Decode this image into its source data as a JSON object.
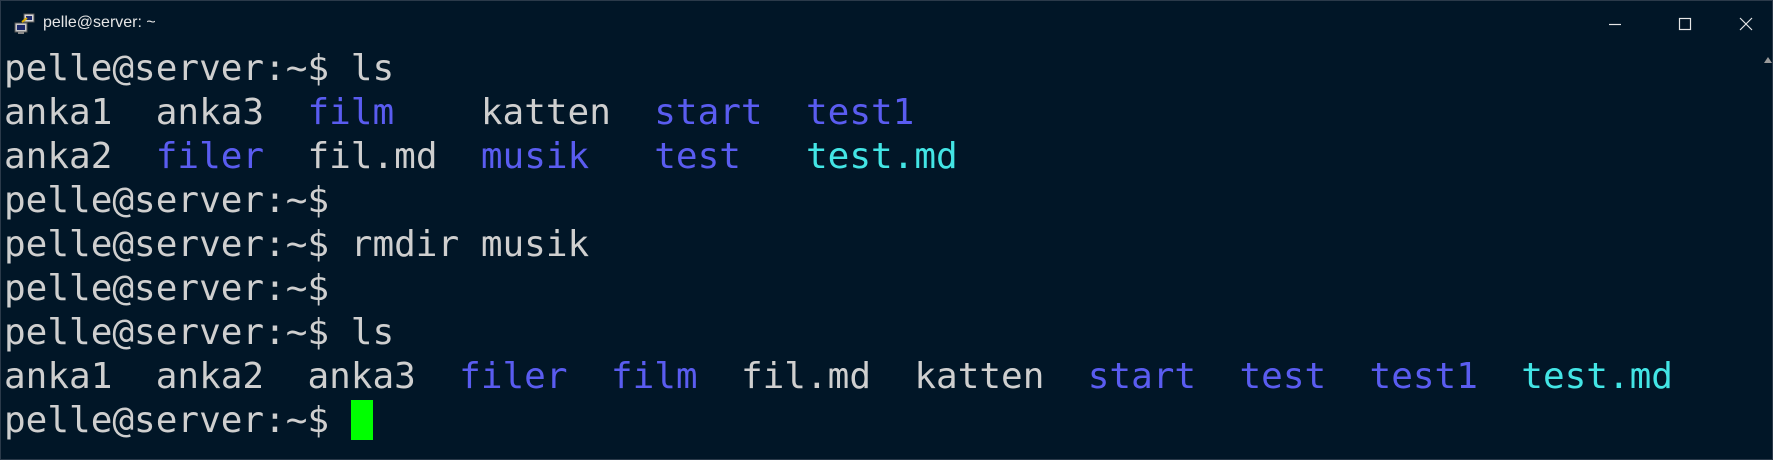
{
  "window": {
    "title": "pelle@server: ~",
    "icon": "putty-terminal-icon",
    "controls": {
      "minimize": "minimize-icon",
      "maximize": "maximize-icon",
      "close": "close-icon"
    }
  },
  "colors": {
    "background": "#011627",
    "text": "#cfcfcf",
    "directory": "#5a5cf0",
    "markdown_file": "#43e5e5",
    "cursor": "#00ff00"
  },
  "terminal": {
    "lines": [
      {
        "type": "prompt",
        "prompt": "pelle@server:~$ ",
        "command": "ls"
      },
      {
        "type": "listing",
        "entries": [
          {
            "text": "anka1  ",
            "kind": "file"
          },
          {
            "text": "anka3  ",
            "kind": "file"
          },
          {
            "text": "film",
            "kind": "dir"
          },
          {
            "text": "    ",
            "kind": "file"
          },
          {
            "text": "katten  ",
            "kind": "file"
          },
          {
            "text": "start",
            "kind": "dir"
          },
          {
            "text": "  ",
            "kind": "file"
          },
          {
            "text": "test1",
            "kind": "dir"
          }
        ]
      },
      {
        "type": "listing",
        "entries": [
          {
            "text": "anka2  ",
            "kind": "file"
          },
          {
            "text": "filer",
            "kind": "dir"
          },
          {
            "text": "  ",
            "kind": "file"
          },
          {
            "text": "fil.md  ",
            "kind": "file"
          },
          {
            "text": "musik",
            "kind": "dir"
          },
          {
            "text": "   ",
            "kind": "file"
          },
          {
            "text": "test",
            "kind": "dir"
          },
          {
            "text": "   ",
            "kind": "file"
          },
          {
            "text": "test.md",
            "kind": "md"
          }
        ]
      },
      {
        "type": "prompt",
        "prompt": "pelle@server:~$",
        "command": ""
      },
      {
        "type": "prompt",
        "prompt": "pelle@server:~$ ",
        "command": "rmdir musik"
      },
      {
        "type": "prompt",
        "prompt": "pelle@server:~$",
        "command": ""
      },
      {
        "type": "prompt",
        "prompt": "pelle@server:~$ ",
        "command": "ls"
      },
      {
        "type": "listing",
        "entries": [
          {
            "text": "anka1  ",
            "kind": "file"
          },
          {
            "text": "anka2  ",
            "kind": "file"
          },
          {
            "text": "anka3  ",
            "kind": "file"
          },
          {
            "text": "filer",
            "kind": "dir"
          },
          {
            "text": "  ",
            "kind": "file"
          },
          {
            "text": "film",
            "kind": "dir"
          },
          {
            "text": "  ",
            "kind": "file"
          },
          {
            "text": "fil.md  ",
            "kind": "file"
          },
          {
            "text": "katten  ",
            "kind": "file"
          },
          {
            "text": "start",
            "kind": "dir"
          },
          {
            "text": "  ",
            "kind": "file"
          },
          {
            "text": "test",
            "kind": "dir"
          },
          {
            "text": "  ",
            "kind": "file"
          },
          {
            "text": "test1",
            "kind": "dir"
          },
          {
            "text": "  ",
            "kind": "file"
          },
          {
            "text": "test.md",
            "kind": "md"
          }
        ]
      },
      {
        "type": "prompt",
        "prompt": "pelle@server:~$ ",
        "command": "",
        "cursor": true
      }
    ]
  }
}
